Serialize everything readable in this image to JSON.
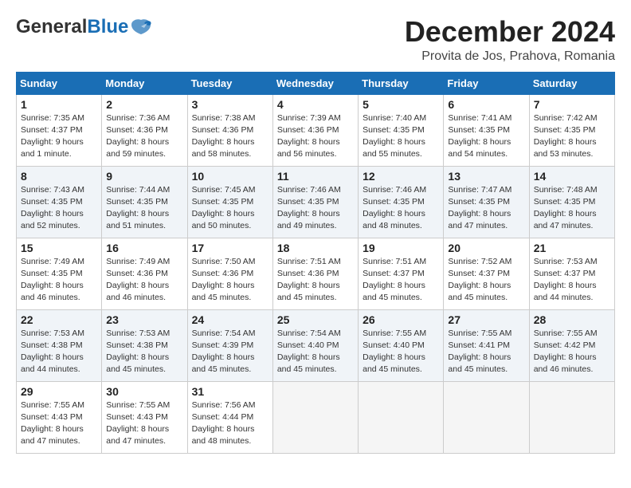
{
  "header": {
    "logo_general": "General",
    "logo_blue": "Blue",
    "month_title": "December 2024",
    "location": "Provita de Jos, Prahova, Romania"
  },
  "weekdays": [
    "Sunday",
    "Monday",
    "Tuesday",
    "Wednesday",
    "Thursday",
    "Friday",
    "Saturday"
  ],
  "weeks": [
    [
      {
        "day": 1,
        "sunrise": "Sunrise: 7:35 AM",
        "sunset": "Sunset: 4:37 PM",
        "daylight": "Daylight: 9 hours and 1 minute."
      },
      {
        "day": 2,
        "sunrise": "Sunrise: 7:36 AM",
        "sunset": "Sunset: 4:36 PM",
        "daylight": "Daylight: 8 hours and 59 minutes."
      },
      {
        "day": 3,
        "sunrise": "Sunrise: 7:38 AM",
        "sunset": "Sunset: 4:36 PM",
        "daylight": "Daylight: 8 hours and 58 minutes."
      },
      {
        "day": 4,
        "sunrise": "Sunrise: 7:39 AM",
        "sunset": "Sunset: 4:36 PM",
        "daylight": "Daylight: 8 hours and 56 minutes."
      },
      {
        "day": 5,
        "sunrise": "Sunrise: 7:40 AM",
        "sunset": "Sunset: 4:35 PM",
        "daylight": "Daylight: 8 hours and 55 minutes."
      },
      {
        "day": 6,
        "sunrise": "Sunrise: 7:41 AM",
        "sunset": "Sunset: 4:35 PM",
        "daylight": "Daylight: 8 hours and 54 minutes."
      },
      {
        "day": 7,
        "sunrise": "Sunrise: 7:42 AM",
        "sunset": "Sunset: 4:35 PM",
        "daylight": "Daylight: 8 hours and 53 minutes."
      }
    ],
    [
      {
        "day": 8,
        "sunrise": "Sunrise: 7:43 AM",
        "sunset": "Sunset: 4:35 PM",
        "daylight": "Daylight: 8 hours and 52 minutes."
      },
      {
        "day": 9,
        "sunrise": "Sunrise: 7:44 AM",
        "sunset": "Sunset: 4:35 PM",
        "daylight": "Daylight: 8 hours and 51 minutes."
      },
      {
        "day": 10,
        "sunrise": "Sunrise: 7:45 AM",
        "sunset": "Sunset: 4:35 PM",
        "daylight": "Daylight: 8 hours and 50 minutes."
      },
      {
        "day": 11,
        "sunrise": "Sunrise: 7:46 AM",
        "sunset": "Sunset: 4:35 PM",
        "daylight": "Daylight: 8 hours and 49 minutes."
      },
      {
        "day": 12,
        "sunrise": "Sunrise: 7:46 AM",
        "sunset": "Sunset: 4:35 PM",
        "daylight": "Daylight: 8 hours and 48 minutes."
      },
      {
        "day": 13,
        "sunrise": "Sunrise: 7:47 AM",
        "sunset": "Sunset: 4:35 PM",
        "daylight": "Daylight: 8 hours and 47 minutes."
      },
      {
        "day": 14,
        "sunrise": "Sunrise: 7:48 AM",
        "sunset": "Sunset: 4:35 PM",
        "daylight": "Daylight: 8 hours and 47 minutes."
      }
    ],
    [
      {
        "day": 15,
        "sunrise": "Sunrise: 7:49 AM",
        "sunset": "Sunset: 4:35 PM",
        "daylight": "Daylight: 8 hours and 46 minutes."
      },
      {
        "day": 16,
        "sunrise": "Sunrise: 7:49 AM",
        "sunset": "Sunset: 4:36 PM",
        "daylight": "Daylight: 8 hours and 46 minutes."
      },
      {
        "day": 17,
        "sunrise": "Sunrise: 7:50 AM",
        "sunset": "Sunset: 4:36 PM",
        "daylight": "Daylight: 8 hours and 45 minutes."
      },
      {
        "day": 18,
        "sunrise": "Sunrise: 7:51 AM",
        "sunset": "Sunset: 4:36 PM",
        "daylight": "Daylight: 8 hours and 45 minutes."
      },
      {
        "day": 19,
        "sunrise": "Sunrise: 7:51 AM",
        "sunset": "Sunset: 4:37 PM",
        "daylight": "Daylight: 8 hours and 45 minutes."
      },
      {
        "day": 20,
        "sunrise": "Sunrise: 7:52 AM",
        "sunset": "Sunset: 4:37 PM",
        "daylight": "Daylight: 8 hours and 45 minutes."
      },
      {
        "day": 21,
        "sunrise": "Sunrise: 7:53 AM",
        "sunset": "Sunset: 4:37 PM",
        "daylight": "Daylight: 8 hours and 44 minutes."
      }
    ],
    [
      {
        "day": 22,
        "sunrise": "Sunrise: 7:53 AM",
        "sunset": "Sunset: 4:38 PM",
        "daylight": "Daylight: 8 hours and 44 minutes."
      },
      {
        "day": 23,
        "sunrise": "Sunrise: 7:53 AM",
        "sunset": "Sunset: 4:38 PM",
        "daylight": "Daylight: 8 hours and 45 minutes."
      },
      {
        "day": 24,
        "sunrise": "Sunrise: 7:54 AM",
        "sunset": "Sunset: 4:39 PM",
        "daylight": "Daylight: 8 hours and 45 minutes."
      },
      {
        "day": 25,
        "sunrise": "Sunrise: 7:54 AM",
        "sunset": "Sunset: 4:40 PM",
        "daylight": "Daylight: 8 hours and 45 minutes."
      },
      {
        "day": 26,
        "sunrise": "Sunrise: 7:55 AM",
        "sunset": "Sunset: 4:40 PM",
        "daylight": "Daylight: 8 hours and 45 minutes."
      },
      {
        "day": 27,
        "sunrise": "Sunrise: 7:55 AM",
        "sunset": "Sunset: 4:41 PM",
        "daylight": "Daylight: 8 hours and 45 minutes."
      },
      {
        "day": 28,
        "sunrise": "Sunrise: 7:55 AM",
        "sunset": "Sunset: 4:42 PM",
        "daylight": "Daylight: 8 hours and 46 minutes."
      }
    ],
    [
      {
        "day": 29,
        "sunrise": "Sunrise: 7:55 AM",
        "sunset": "Sunset: 4:43 PM",
        "daylight": "Daylight: 8 hours and 47 minutes."
      },
      {
        "day": 30,
        "sunrise": "Sunrise: 7:55 AM",
        "sunset": "Sunset: 4:43 PM",
        "daylight": "Daylight: 8 hours and 47 minutes."
      },
      {
        "day": 31,
        "sunrise": "Sunrise: 7:56 AM",
        "sunset": "Sunset: 4:44 PM",
        "daylight": "Daylight: 8 hours and 48 minutes."
      },
      null,
      null,
      null,
      null
    ]
  ]
}
